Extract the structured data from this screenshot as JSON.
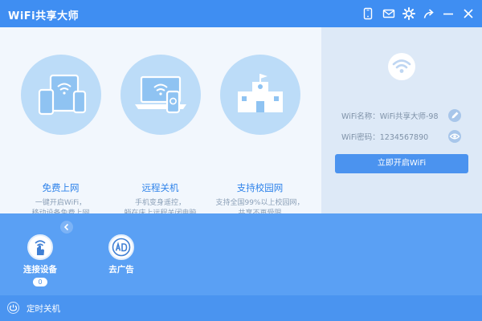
{
  "window": {
    "title": "WiFi共享大师",
    "icons": [
      "phone-icon",
      "mail-icon",
      "settings-gear-icon",
      "share-arrow-icon",
      "minimize-icon",
      "close-icon"
    ]
  },
  "features": [
    {
      "title": "免费上网",
      "desc_line1": "一键开启WiFi，",
      "desc_line2": "移动设备免费上网",
      "icon": "devices-icon"
    },
    {
      "title": "远程关机",
      "desc_line1": "手机变身遥控，",
      "desc_line2": "躺在床上远程关闭电脑",
      "icon": "laptop-phone-icon"
    },
    {
      "title": "支持校园网",
      "desc_line1": "支持全国99%以上校园网，",
      "desc_line2": "共享不再受限",
      "icon": "school-icon"
    }
  ],
  "wifi_panel": {
    "name_label": "WiFi名称：",
    "name_value": "WiFi共享大师-98",
    "password_label": "WiFi密码：",
    "password_value": "1234567890",
    "start_button": "立即开启WiFi"
  },
  "tools": [
    {
      "label": "连接设备",
      "icon": "wifi-hand-icon",
      "count": "0"
    },
    {
      "label": "去广告",
      "icon": "ad-block-icon"
    }
  ],
  "statusbar": {
    "label": "定时关机"
  },
  "colors": {
    "titlebar": "#3f8ef2",
    "accent": "#2f83ea",
    "bottom_panel": "#5aa0f4",
    "statusbar": "#4a94f0",
    "feature_circle": "#bcdcf8"
  }
}
